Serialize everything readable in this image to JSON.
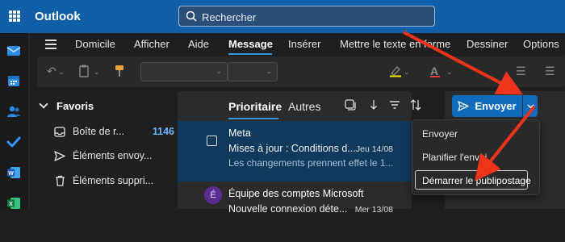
{
  "app": {
    "title": "Outlook"
  },
  "search": {
    "placeholder": "Rechercher"
  },
  "ribbon": {
    "tabs": [
      {
        "label": "Domicile"
      },
      {
        "label": "Afficher"
      },
      {
        "label": "Aide"
      },
      {
        "label": "Message"
      },
      {
        "label": "Insérer"
      },
      {
        "label": "Mettre le texte en forme"
      },
      {
        "label": "Dessiner"
      },
      {
        "label": "Options"
      }
    ],
    "active_tab": "Message"
  },
  "folders": {
    "favorites_label": "Favoris",
    "items": [
      {
        "label": "Boîte de r...",
        "count": "1146",
        "icon": "inbox-icon"
      },
      {
        "label": "Éléments envoy...",
        "icon": "send-icon"
      },
      {
        "label": "Éléments suppri...",
        "icon": "trash-icon"
      }
    ]
  },
  "mail_list": {
    "tabs": {
      "focused": "Prioritaire",
      "other": "Autres"
    },
    "messages": [
      {
        "sender": "Meta",
        "subject": "Mises à jour : Conditions d...",
        "date": "Jeu 14/08",
        "preview": "Les changements prennent effet le 1...",
        "selected": true
      },
      {
        "sender": "Équipe des comptes Microsoft",
        "subject": "Nouvelle connexion déte...",
        "date": "Mer 13/08",
        "avatar": "É"
      }
    ]
  },
  "send": {
    "label": "Envoyer"
  },
  "send_menu": {
    "items": [
      {
        "label": "Envoyer"
      },
      {
        "label": "Planifier l'envoi"
      },
      {
        "label": "Démarrer le publipostage",
        "highlighted": true
      }
    ]
  },
  "colors": {
    "brand": "#0f5fa8",
    "accent": "#0f6cbd",
    "annotation_arrow": "#f0341c"
  }
}
